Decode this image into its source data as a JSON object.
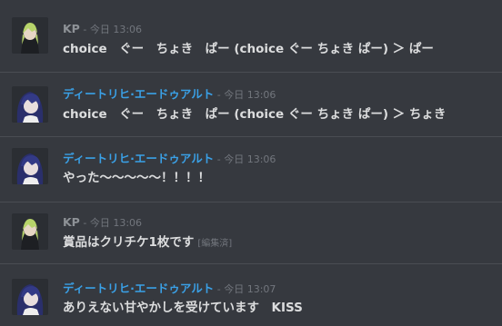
{
  "theme": {
    "background": "#36393f",
    "kp_name_color": "#8e9297",
    "ditrich_name_color": "#3aa0e6",
    "timestamp_color": "#72767d"
  },
  "messages": [
    {
      "author": "KP",
      "sep": " - ",
      "time": "今日 13:06",
      "text": "choice　ぐー　ちょき　ぱー (choice ぐー ちょき ぱー) ＞ ぱー",
      "edited": ""
    },
    {
      "author": "ディートリヒ·エードゥアルト",
      "sep": " - ",
      "time": "今日 13:06",
      "text": "choice　ぐー　ちょき　ぱー (choice ぐー ちょき ぱー) ＞ ちょき",
      "edited": ""
    },
    {
      "author": "ディートリヒ·エードゥアルト",
      "sep": " - ",
      "time": "今日 13:06",
      "text": "やった〜〜〜〜〜！！！！",
      "edited": ""
    },
    {
      "author": "KP",
      "sep": " - ",
      "time": "今日 13:06",
      "text": "賞品はクリチケ1枚です",
      "edited": "[編集済]"
    },
    {
      "author": "ディートリヒ·エードゥアルト",
      "sep": " - ",
      "time": "今日 13:07",
      "text": "ありえない甘やかしを受けています　KISS",
      "edited": ""
    }
  ]
}
